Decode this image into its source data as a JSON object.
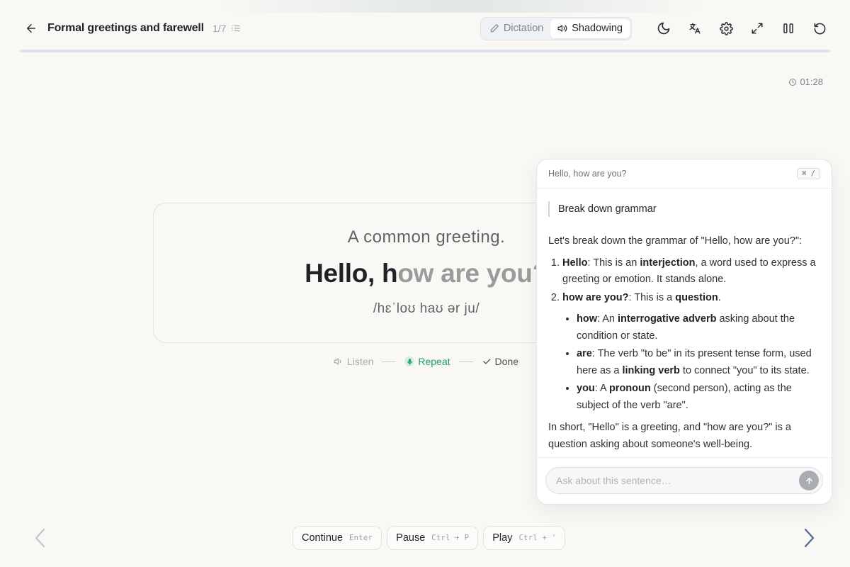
{
  "header": {
    "title": "Formal greetings and farewell",
    "count": "1/7",
    "modes": {
      "dictation": "Dictation",
      "shadowing": "Shadowing",
      "active": "shadowing"
    },
    "icons": [
      "back-arrow-icon",
      "list-icon",
      "pencil-icon",
      "speaker-icon",
      "moon-icon",
      "translate-icon",
      "gear-icon",
      "expand-icon",
      "columns-icon",
      "restart-icon"
    ]
  },
  "progress": {
    "value": 0
  },
  "timer": {
    "value": "01:28"
  },
  "card": {
    "hint": "A common greeting.",
    "sentence_typed": "Hello, h",
    "sentence_rest": "ow are you?",
    "ipa": "/hɛˈloʊ haʊ ər ju/"
  },
  "steps": {
    "listen": "Listen",
    "repeat": "Repeat",
    "done": "Done",
    "active": "repeat"
  },
  "panel": {
    "sentence": "Hello, how are you?",
    "shortcut": "⌘ /",
    "prompt": "Break down grammar",
    "intro": "Let's break down the grammar of \"Hello, how are you?\":",
    "items": {
      "hello_term": "Hello",
      "hello_a": ": This is an ",
      "hello_b": "interjection",
      "hello_c": ", a word used to express a greeting or emotion. It stands alone.",
      "hay_term": "how are you?",
      "hay_a": ": This is a ",
      "hay_b": "question",
      "hay_c": "."
    },
    "subitems": {
      "how_term": "how",
      "how_a": ": An ",
      "how_b": "interrogative adverb",
      "how_c": " asking about the condition or state.",
      "are_term": "are",
      "are_a": ": The verb \"to be\" in its present tense form, used here as a ",
      "are_b": "linking verb",
      "are_c": " to connect \"you\" to its state.",
      "you_term": "you",
      "you_a": ": A ",
      "you_b": "pronoun",
      "you_c": " (second person), acting as the subject of the verb \"are\"."
    },
    "summary": "In short, \"Hello\" is a greeting, and \"how are you?\" is a question asking about someone's well-being.",
    "input_placeholder": "Ask about this sentence…"
  },
  "controls": {
    "continue_label": "Continue",
    "continue_key": "Enter",
    "pause_label": "Pause",
    "pause_key": "Ctrl + P",
    "play_label": "Play",
    "play_key": "Ctrl + '"
  },
  "colors": {
    "accent_green": "#1f9e6a",
    "next_arrow": "#4f6a8a",
    "background": "#f9f8f5"
  }
}
